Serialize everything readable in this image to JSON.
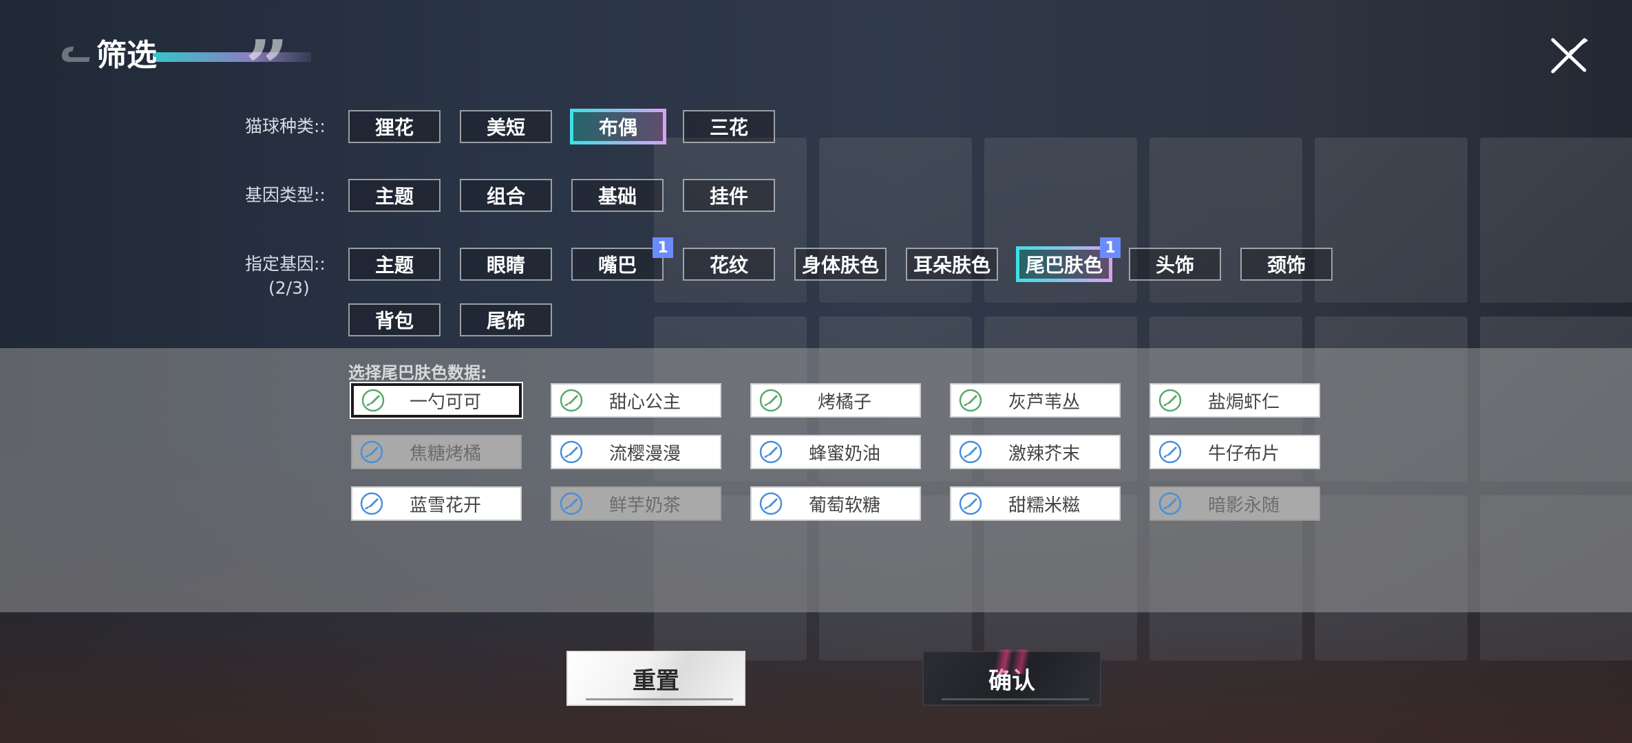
{
  "header": {
    "title": "筛选"
  },
  "rows": {
    "cat_type": {
      "label": "猫球种类::",
      "options": [
        "狸花",
        "美短",
        "布偶",
        "三花"
      ],
      "selected": "布偶"
    },
    "gene_type": {
      "label": "基因类型::",
      "options": [
        "主题",
        "组合",
        "基础",
        "挂件"
      ]
    },
    "specified_gene": {
      "label": "指定基因::",
      "count": "(2/3)",
      "options": [
        "主题",
        "眼睛",
        "嘴巴",
        "花纹",
        "身体肤色",
        "耳朵肤色",
        "尾巴肤色",
        "头饰",
        "颈饰",
        "背包",
        "尾饰"
      ],
      "selected": "尾巴肤色",
      "badges": {
        "嘴巴": "1",
        "尾巴肤色": "1"
      }
    }
  },
  "data_panel": {
    "label": "选择尾巴肤色数据:",
    "options": [
      {
        "label": "一勺可可",
        "icon": "green-brush-icon",
        "state": "active"
      },
      {
        "label": "甜心公主",
        "icon": "green-brush-icon",
        "state": "normal"
      },
      {
        "label": "烤橘子",
        "icon": "green-brush-icon",
        "state": "normal"
      },
      {
        "label": "灰芦苇丛",
        "icon": "green-brush-icon",
        "state": "normal"
      },
      {
        "label": "盐焗虾仁",
        "icon": "green-brush-icon",
        "state": "normal"
      },
      {
        "label": "焦糖烤橘",
        "icon": "blue-brush-icon",
        "state": "disabled"
      },
      {
        "label": "流樱漫漫",
        "icon": "blue-brush-icon",
        "state": "normal"
      },
      {
        "label": "蜂蜜奶油",
        "icon": "blue-brush-icon",
        "state": "normal"
      },
      {
        "label": "激辣芥末",
        "icon": "blue-brush-icon",
        "state": "normal"
      },
      {
        "label": "牛仔布片",
        "icon": "blue-brush-icon",
        "state": "normal"
      },
      {
        "label": "蓝雪花开",
        "icon": "blue-brush-icon",
        "state": "normal"
      },
      {
        "label": "鲜芋奶茶",
        "icon": "blue-brush-icon",
        "state": "disabled"
      },
      {
        "label": "葡萄软糖",
        "icon": "blue-brush-icon",
        "state": "normal"
      },
      {
        "label": "甜糯米糍",
        "icon": "blue-brush-icon",
        "state": "normal"
      },
      {
        "label": "暗影永随",
        "icon": "blue-brush-icon",
        "state": "disabled"
      }
    ]
  },
  "buttons": {
    "reset": "重置",
    "confirm": "确认"
  },
  "colors": {
    "selected_border_start": "#3de0e6",
    "selected_border_end": "#d8a2f0",
    "badge": "#6b8cff",
    "green_icon": "#5aa86a",
    "blue_icon": "#4a8fd6"
  }
}
